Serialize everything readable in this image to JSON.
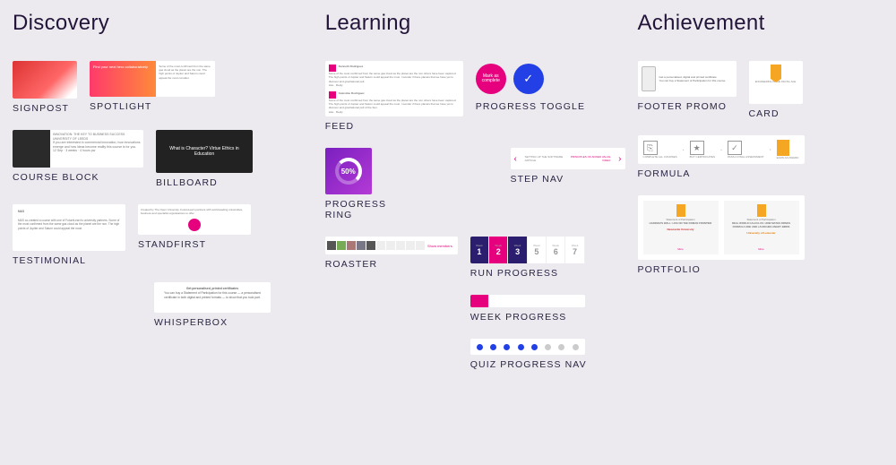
{
  "columns": {
    "discovery": {
      "title": "Discovery",
      "items": {
        "signpost": "SIGNPOST",
        "spotlight": "SPOTLIGHT",
        "courseblock": "COURSE BLOCK",
        "billboard": "BILLBOARD",
        "testimonial": "TESTIMONIAL",
        "standfirst": "STANDFIRST",
        "whisperbox": "WHISPERBOX"
      }
    },
    "learning": {
      "title": "Learning",
      "items": {
        "feed": "FEED",
        "progresstoggle": "PROGRESS TOGGLE",
        "progressring": "PROGRESS RING",
        "stepnav": "STEP NAV",
        "roaster": "ROASTER",
        "runprogress": "RUN PROGRESS",
        "weekprogress": "WEEK PROGRESS",
        "quizprogressnav": "QUIZ PROGRESS NAV"
      }
    },
    "achievement": {
      "title": "Achievement",
      "items": {
        "footerpromo": "FOOTER PROMO",
        "card": "CARD",
        "formula": "FORMULA",
        "portfolio": "PORTFOLIO"
      }
    }
  },
  "thumbs": {
    "billboard_text": "What is Character? Virtue Ethics in Education",
    "progressring_value": "50%",
    "progresstoggle_mark": "Mark as complete",
    "progresstoggle_check": "✓",
    "testimonial_brand": "M&S",
    "roaster_link": "Show members",
    "runprogress_weeks": [
      "1",
      "2",
      "3",
      "5",
      "6",
      "7"
    ],
    "formula_ops": [
      "+",
      "+",
      "="
    ],
    "portfolio_more": "More"
  }
}
